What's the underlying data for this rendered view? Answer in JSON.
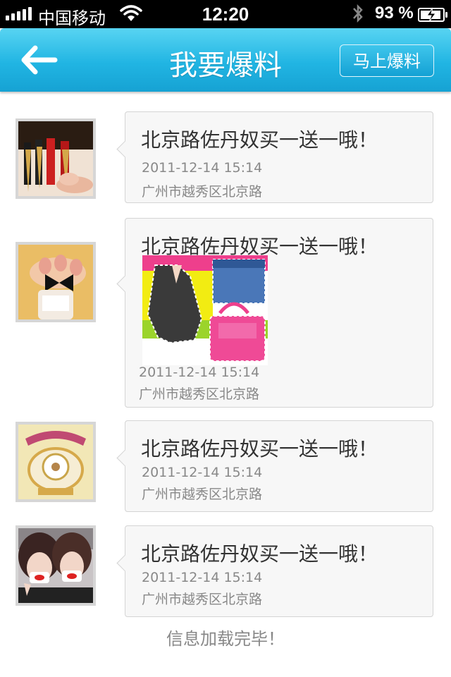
{
  "status_bar": {
    "carrier": "中国移动",
    "time": "12:20",
    "battery_percent": "93 %",
    "battery_level": 0.93,
    "icons": [
      "signal-icon",
      "wifi-icon",
      "bluetooth-icon",
      "battery-icon"
    ]
  },
  "nav": {
    "title": "我要爆料",
    "action_label": "马上爆料",
    "back_icon": "back-arrow-icon"
  },
  "colors": {
    "nav_top": "#58d4f2",
    "nav_bottom": "#16a2d3",
    "card_bg": "#f7f7f7",
    "card_border": "#d4d4d4",
    "title_text": "#333333",
    "meta_text": "#888888"
  },
  "feed": [
    {
      "title": "北京路佐丹奴买一送一哦！",
      "date": "2011-12-14 15:14",
      "location": "广州市越秀区北京路",
      "avatar": "belts-photo",
      "has_photo": false
    },
    {
      "title": "北京路佐丹奴买一送一哦！",
      "date": "2011-12-14 15:14",
      "location": "广州市越秀区北京路",
      "avatar": "nail-polish-photo",
      "has_photo": true
    },
    {
      "title": "北京路佐丹奴买一送一哦！",
      "date": "2011-12-14 15:14",
      "location": "广州市越秀区北京路",
      "avatar": "telephone-photo",
      "has_photo": false
    },
    {
      "title": "北京路佐丹奴买一送一哦！",
      "date": "2011-12-14 15:14",
      "location": "广州市越秀区北京路",
      "avatar": "girls-photo",
      "has_photo": false
    }
  ],
  "footer": {
    "message": "信息加载完毕！"
  }
}
